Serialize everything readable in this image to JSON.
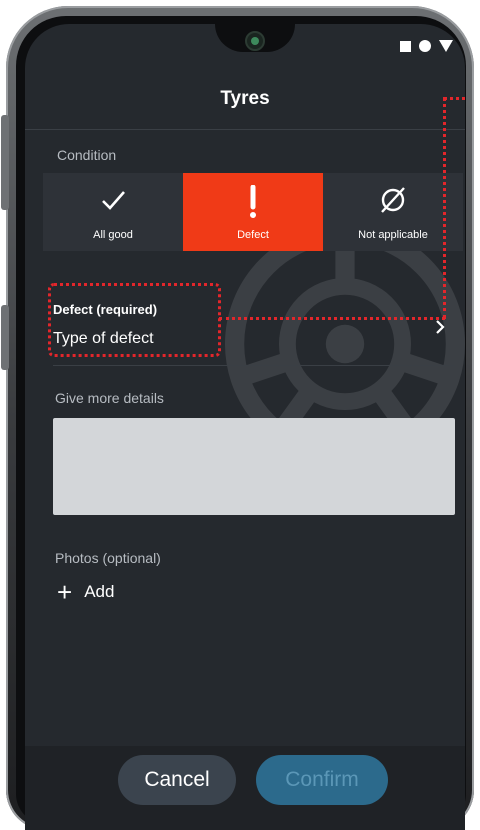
{
  "header": {
    "title": "Tyres"
  },
  "condition": {
    "label": "Condition",
    "options": [
      {
        "label": "All good",
        "icon": "check-icon",
        "selected": false
      },
      {
        "label": "Defect",
        "icon": "exclamation-icon",
        "selected": true
      },
      {
        "label": "Not applicable",
        "icon": "not-applicable-icon",
        "selected": false
      }
    ],
    "accent_color": "#f03a17"
  },
  "defect": {
    "label": "Defect (required)",
    "value": "Type of defect",
    "highlight_color": "#e3262b"
  },
  "details": {
    "label": "Give more details",
    "value": ""
  },
  "photos": {
    "label": "Photos (optional)",
    "add_label": "Add"
  },
  "actions": {
    "cancel_label": "Cancel",
    "confirm_label": "Confirm"
  }
}
